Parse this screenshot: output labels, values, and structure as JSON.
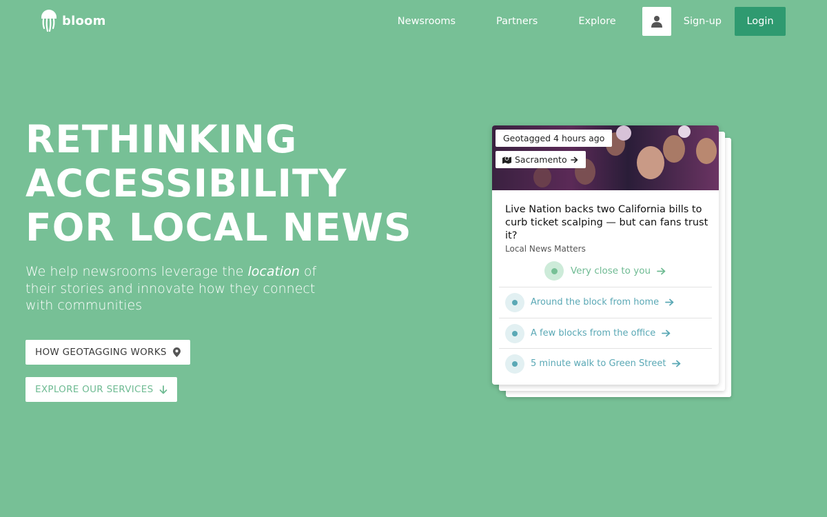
{
  "header": {
    "logo_text": "bloom",
    "nav": [
      "Newsrooms",
      "Partners",
      "Explore"
    ],
    "signup_label": "Sign-up",
    "login_label": "Login"
  },
  "hero": {
    "title_lines": [
      "RETHINKING",
      "ACCESSIBILITY",
      "FOR LOCAL NEWS"
    ],
    "subtitle_before": "We help newsrooms leverage the ",
    "subtitle_em": "location",
    "subtitle_after": " of their stories and innovate how they connect with communities",
    "cta_how": "HOW GEOTAGGING WORKS",
    "cta_explore": "EXPLORE OUR SERVICES"
  },
  "card": {
    "geotag_label": "Geotagged 4 hours ago",
    "city_label": "Sacramento",
    "headline": "Live Nation backs two California bills to curb ticket scalping — but can fans trust it?",
    "source": "Local News Matters",
    "primary_location": "Very close to you",
    "locations": [
      "Around the block from home",
      "A few blocks from the office",
      "5 minute walk to Green Street"
    ]
  },
  "colors": {
    "background": "#77c096",
    "login_button": "#2f9a70",
    "accent_green": "#6fbb93",
    "accent_teal": "#5aa8b5"
  }
}
